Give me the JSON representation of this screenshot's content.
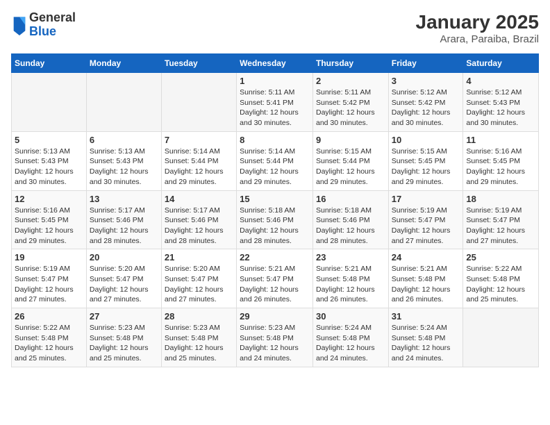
{
  "header": {
    "logo_general": "General",
    "logo_blue": "Blue",
    "title": "January 2025",
    "subtitle": "Arara, Paraiba, Brazil"
  },
  "calendar": {
    "days_of_week": [
      "Sunday",
      "Monday",
      "Tuesday",
      "Wednesday",
      "Thursday",
      "Friday",
      "Saturday"
    ],
    "weeks": [
      [
        {
          "day": "",
          "info": ""
        },
        {
          "day": "",
          "info": ""
        },
        {
          "day": "",
          "info": ""
        },
        {
          "day": "1",
          "info": "Sunrise: 5:11 AM\nSunset: 5:41 PM\nDaylight: 12 hours and 30 minutes."
        },
        {
          "day": "2",
          "info": "Sunrise: 5:11 AM\nSunset: 5:42 PM\nDaylight: 12 hours and 30 minutes."
        },
        {
          "day": "3",
          "info": "Sunrise: 5:12 AM\nSunset: 5:42 PM\nDaylight: 12 hours and 30 minutes."
        },
        {
          "day": "4",
          "info": "Sunrise: 5:12 AM\nSunset: 5:43 PM\nDaylight: 12 hours and 30 minutes."
        }
      ],
      [
        {
          "day": "5",
          "info": "Sunrise: 5:13 AM\nSunset: 5:43 PM\nDaylight: 12 hours and 30 minutes."
        },
        {
          "day": "6",
          "info": "Sunrise: 5:13 AM\nSunset: 5:43 PM\nDaylight: 12 hours and 30 minutes."
        },
        {
          "day": "7",
          "info": "Sunrise: 5:14 AM\nSunset: 5:44 PM\nDaylight: 12 hours and 29 minutes."
        },
        {
          "day": "8",
          "info": "Sunrise: 5:14 AM\nSunset: 5:44 PM\nDaylight: 12 hours and 29 minutes."
        },
        {
          "day": "9",
          "info": "Sunrise: 5:15 AM\nSunset: 5:44 PM\nDaylight: 12 hours and 29 minutes."
        },
        {
          "day": "10",
          "info": "Sunrise: 5:15 AM\nSunset: 5:45 PM\nDaylight: 12 hours and 29 minutes."
        },
        {
          "day": "11",
          "info": "Sunrise: 5:16 AM\nSunset: 5:45 PM\nDaylight: 12 hours and 29 minutes."
        }
      ],
      [
        {
          "day": "12",
          "info": "Sunrise: 5:16 AM\nSunset: 5:45 PM\nDaylight: 12 hours and 29 minutes."
        },
        {
          "day": "13",
          "info": "Sunrise: 5:17 AM\nSunset: 5:46 PM\nDaylight: 12 hours and 28 minutes."
        },
        {
          "day": "14",
          "info": "Sunrise: 5:17 AM\nSunset: 5:46 PM\nDaylight: 12 hours and 28 minutes."
        },
        {
          "day": "15",
          "info": "Sunrise: 5:18 AM\nSunset: 5:46 PM\nDaylight: 12 hours and 28 minutes."
        },
        {
          "day": "16",
          "info": "Sunrise: 5:18 AM\nSunset: 5:46 PM\nDaylight: 12 hours and 28 minutes."
        },
        {
          "day": "17",
          "info": "Sunrise: 5:19 AM\nSunset: 5:47 PM\nDaylight: 12 hours and 27 minutes."
        },
        {
          "day": "18",
          "info": "Sunrise: 5:19 AM\nSunset: 5:47 PM\nDaylight: 12 hours and 27 minutes."
        }
      ],
      [
        {
          "day": "19",
          "info": "Sunrise: 5:19 AM\nSunset: 5:47 PM\nDaylight: 12 hours and 27 minutes."
        },
        {
          "day": "20",
          "info": "Sunrise: 5:20 AM\nSunset: 5:47 PM\nDaylight: 12 hours and 27 minutes."
        },
        {
          "day": "21",
          "info": "Sunrise: 5:20 AM\nSunset: 5:47 PM\nDaylight: 12 hours and 27 minutes."
        },
        {
          "day": "22",
          "info": "Sunrise: 5:21 AM\nSunset: 5:47 PM\nDaylight: 12 hours and 26 minutes."
        },
        {
          "day": "23",
          "info": "Sunrise: 5:21 AM\nSunset: 5:48 PM\nDaylight: 12 hours and 26 minutes."
        },
        {
          "day": "24",
          "info": "Sunrise: 5:21 AM\nSunset: 5:48 PM\nDaylight: 12 hours and 26 minutes."
        },
        {
          "day": "25",
          "info": "Sunrise: 5:22 AM\nSunset: 5:48 PM\nDaylight: 12 hours and 25 minutes."
        }
      ],
      [
        {
          "day": "26",
          "info": "Sunrise: 5:22 AM\nSunset: 5:48 PM\nDaylight: 12 hours and 25 minutes."
        },
        {
          "day": "27",
          "info": "Sunrise: 5:23 AM\nSunset: 5:48 PM\nDaylight: 12 hours and 25 minutes."
        },
        {
          "day": "28",
          "info": "Sunrise: 5:23 AM\nSunset: 5:48 PM\nDaylight: 12 hours and 25 minutes."
        },
        {
          "day": "29",
          "info": "Sunrise: 5:23 AM\nSunset: 5:48 PM\nDaylight: 12 hours and 24 minutes."
        },
        {
          "day": "30",
          "info": "Sunrise: 5:24 AM\nSunset: 5:48 PM\nDaylight: 12 hours and 24 minutes."
        },
        {
          "day": "31",
          "info": "Sunrise: 5:24 AM\nSunset: 5:48 PM\nDaylight: 12 hours and 24 minutes."
        },
        {
          "day": "",
          "info": ""
        }
      ]
    ]
  }
}
